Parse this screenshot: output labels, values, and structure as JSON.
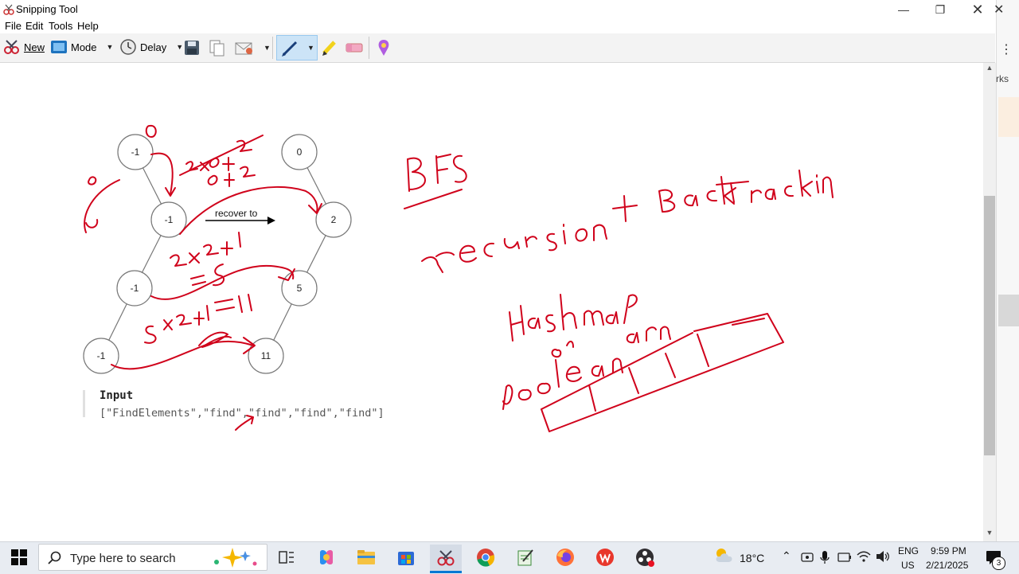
{
  "window": {
    "title": "Snipping Tool",
    "minimize_icon": "minimize-icon",
    "restore_icon": "restore-icon",
    "close_icon": "close-icon"
  },
  "menu": [
    "File",
    "Edit",
    "Tools",
    "Help"
  ],
  "toolbar": {
    "new_label": "New",
    "mode_label": "Mode",
    "delay_label": "Delay",
    "icons": [
      "scissors-icon",
      "mode-icon",
      "clock-icon",
      "save-icon",
      "copy-icon",
      "send-email-icon",
      "pen-icon",
      "highlighter-icon",
      "eraser-icon",
      "paint3d-icon"
    ]
  },
  "background_window": {
    "snippet": "rks"
  },
  "canvas": {
    "graph_nodes": [
      "-1",
      "0",
      "-1",
      "2",
      "-1",
      "5",
      "-1",
      "11"
    ],
    "arrow_label": "recover to",
    "input_heading": "Input",
    "input_value": "[\"FindElements\",\"find\",\"find\",\"find\",\"find\"]"
  },
  "taskbar": {
    "search_placeholder": "Type here to search",
    "apps": [
      "task-view-icon",
      "copilot-icon",
      "file-explorer-icon",
      "store-icon",
      "snipping-tool-icon",
      "chrome-icon",
      "notepad-icon",
      "firefox-icon",
      "wps-icon",
      "obs-icon"
    ],
    "weather": "18°C",
    "language_top": "ENG",
    "language_bottom": "US",
    "time": "9:59 PM",
    "date": "2/21/2025",
    "notifications": "3"
  },
  "colors": {
    "ink": "#d0021b",
    "accent": "#0078d4",
    "taskbar": "#e8ecf2"
  }
}
